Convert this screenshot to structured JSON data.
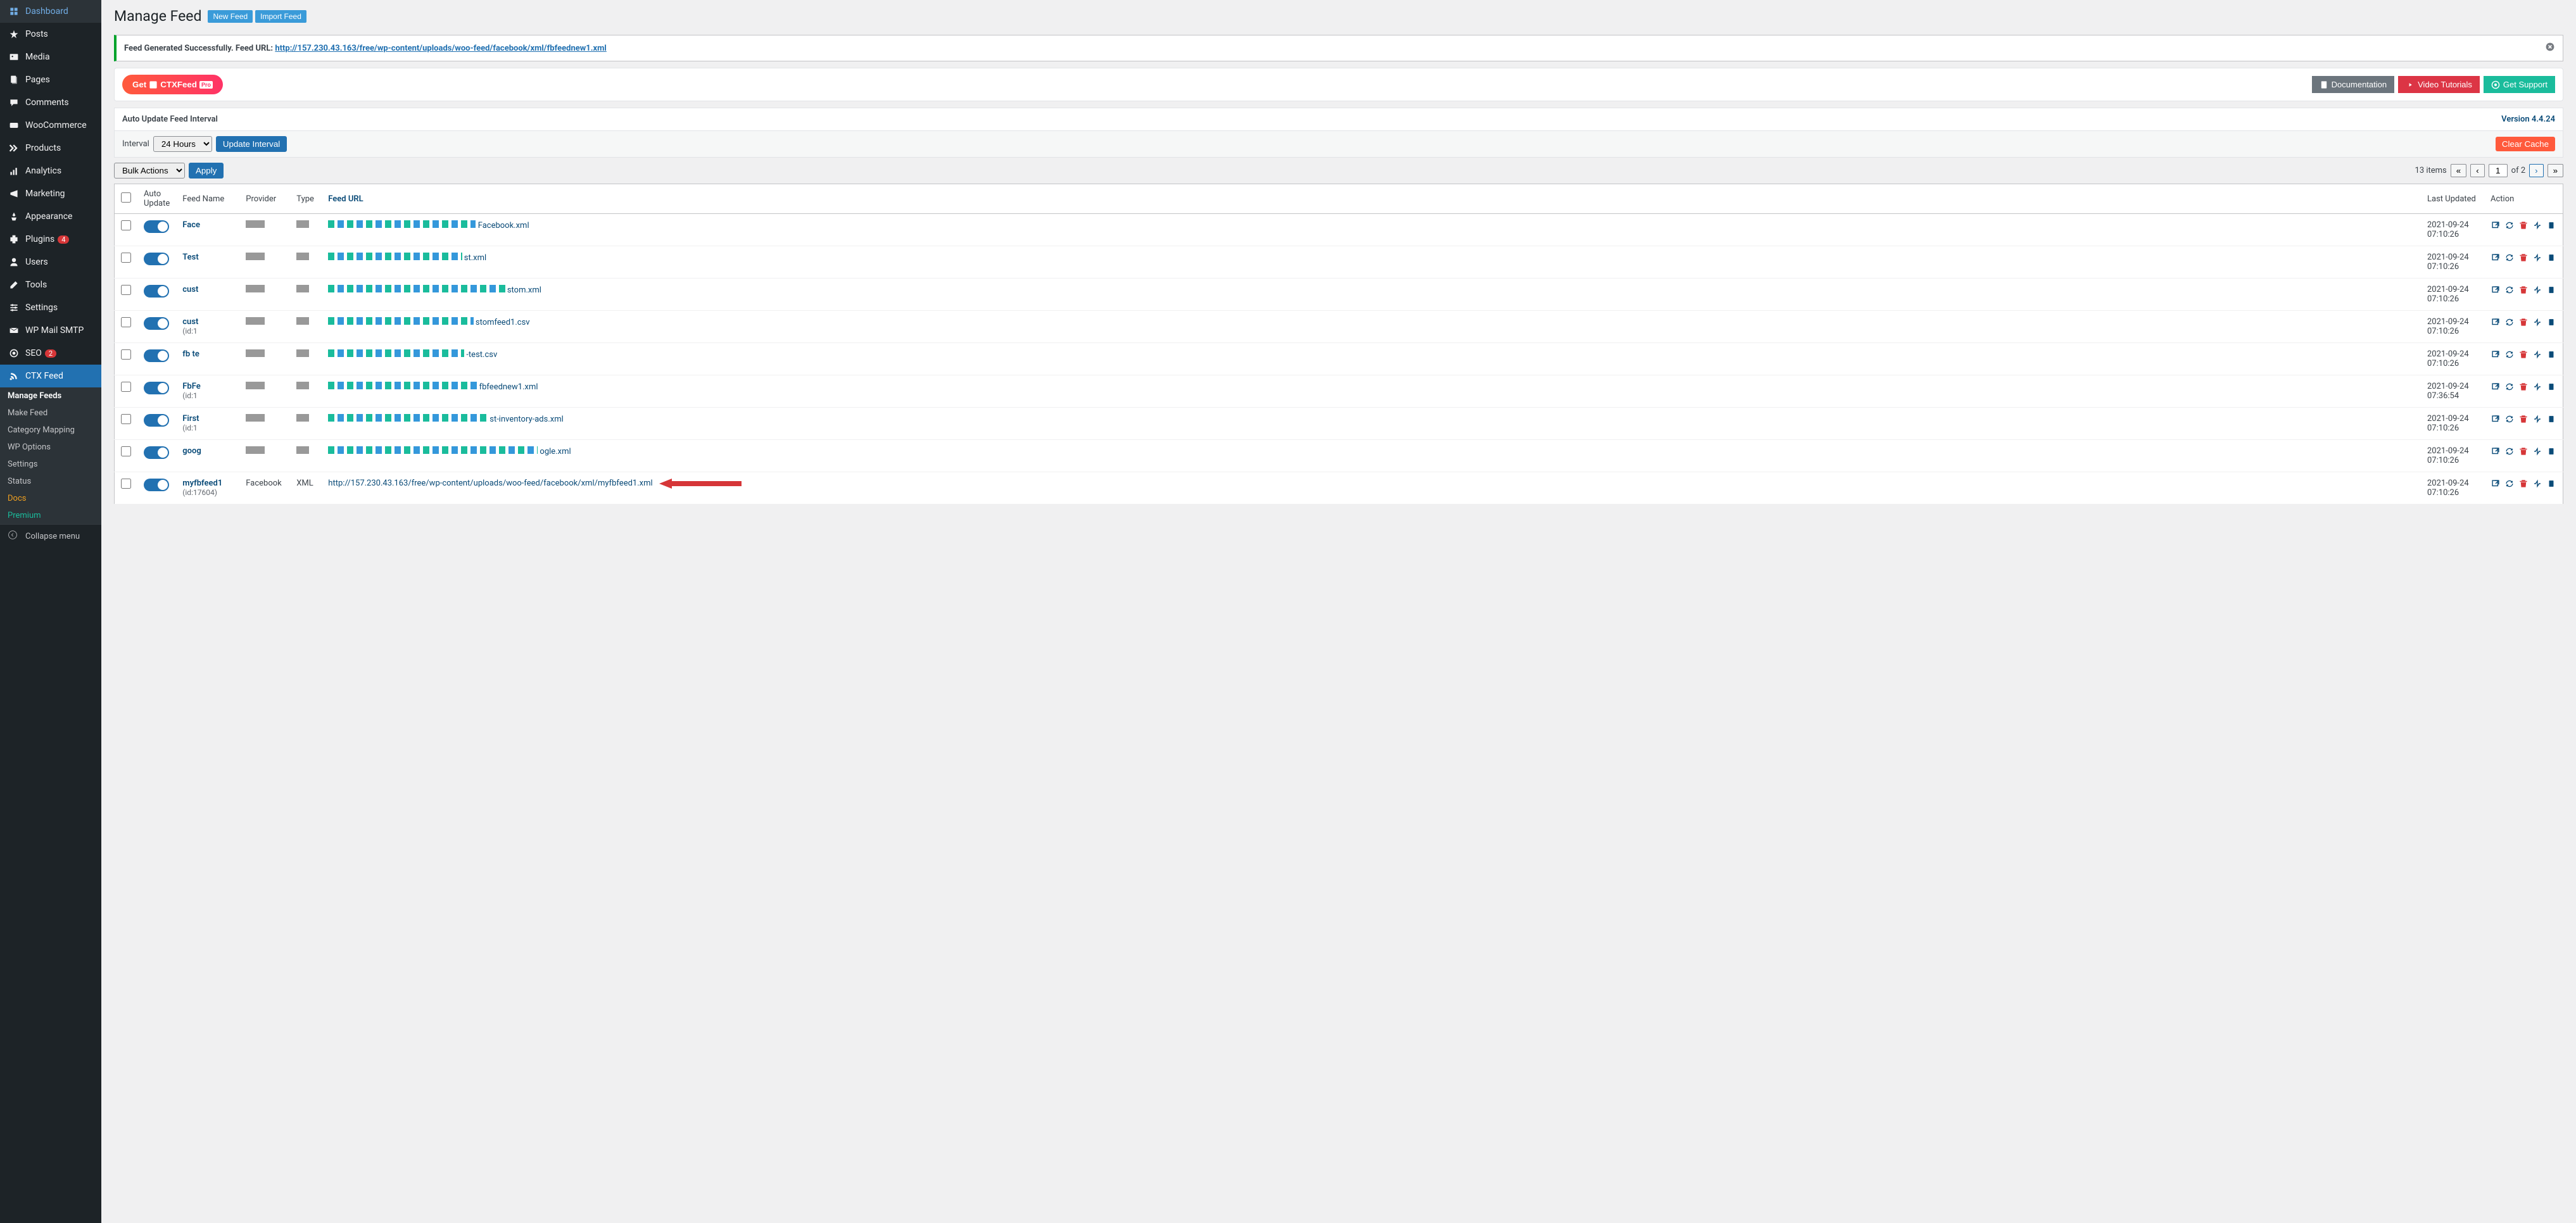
{
  "sidebar": {
    "items": [
      {
        "label": "Dashboard",
        "icon": "dashboard"
      },
      {
        "label": "Posts",
        "icon": "pin"
      },
      {
        "label": "Media",
        "icon": "media"
      },
      {
        "label": "Pages",
        "icon": "pages"
      },
      {
        "label": "Comments",
        "icon": "comments"
      },
      {
        "label": "WooCommerce",
        "icon": "woo"
      },
      {
        "label": "Products",
        "icon": "products"
      },
      {
        "label": "Analytics",
        "icon": "analytics"
      },
      {
        "label": "Marketing",
        "icon": "marketing"
      },
      {
        "label": "Appearance",
        "icon": "appearance"
      },
      {
        "label": "Plugins",
        "icon": "plugins",
        "badge": "4"
      },
      {
        "label": "Users",
        "icon": "users"
      },
      {
        "label": "Tools",
        "icon": "tools"
      },
      {
        "label": "Settings",
        "icon": "settings"
      },
      {
        "label": "WP Mail SMTP",
        "icon": "mail"
      },
      {
        "label": "SEO",
        "icon": "seo",
        "badge": "2"
      },
      {
        "label": "CTX Feed",
        "icon": "feed",
        "active": true
      }
    ],
    "submenu": [
      {
        "label": "Manage Feeds",
        "active": true
      },
      {
        "label": "Make Feed"
      },
      {
        "label": "Category Mapping"
      },
      {
        "label": "WP Options"
      },
      {
        "label": "Settings"
      },
      {
        "label": "Status"
      },
      {
        "label": "Docs",
        "class": "docs"
      },
      {
        "label": "Premium",
        "class": "premium"
      }
    ],
    "collapse": "Collapse menu"
  },
  "header": {
    "title": "Manage Feed",
    "new_feed": "New Feed",
    "import_feed": "Import Feed"
  },
  "notice": {
    "text": "Feed Generated Successfully. Feed URL: ",
    "url": "http://157.230.43.163/free/wp-content/uploads/woo-feed/facebook/xml/fbfeednew1.xml"
  },
  "ctx": {
    "get": "Get",
    "brand": "CTXFeed",
    "pro": "Pro"
  },
  "header_actions": {
    "docs": "Documentation",
    "video": "Video Tutorials",
    "support": "Get Support"
  },
  "interval": {
    "header": "Auto Update Feed Interval",
    "version": "Version 4.4.24",
    "label": "Interval",
    "selected": "24 Hours",
    "update": "Update Interval",
    "clear": "Clear Cache"
  },
  "controls": {
    "bulk": "Bulk Actions",
    "apply": "Apply",
    "items_count": "13 items",
    "page": "1",
    "total_pages": "of 2"
  },
  "columns": {
    "auto_update": "Auto Update",
    "feed_name": "Feed Name",
    "provider": "Provider",
    "type": "Type",
    "feed_url": "Feed URL",
    "last_updated": "Last Updated",
    "action": "Action"
  },
  "rows": [
    {
      "name": "Face",
      "id": "",
      "provider": "",
      "type": "",
      "url_suffix": "Facebook.xml",
      "updated": "2021-09-24 07:10:26"
    },
    {
      "name": "Test",
      "id": "",
      "provider": "",
      "type": "",
      "url_suffix": "st.xml",
      "updated": "2021-09-24 07:10:26"
    },
    {
      "name": "cust",
      "id": "",
      "provider": "",
      "type": "",
      "url_suffix": "stom.xml",
      "updated": "2021-09-24 07:10:26"
    },
    {
      "name": "cust",
      "id": "(id:1",
      "provider": "",
      "type": "",
      "url_suffix": "stomfeed1.csv",
      "updated": "2021-09-24 07:10:26"
    },
    {
      "name": "fb te",
      "id": "",
      "provider": "",
      "type": "",
      "url_suffix": "-test.csv",
      "updated": "2021-09-24 07:10:26"
    },
    {
      "name": "FbFe",
      "id": "(id:1",
      "provider": "",
      "type": "",
      "url_suffix": "fbfeednew1.xml",
      "updated": "2021-09-24 07:36:54"
    },
    {
      "name": "First",
      "id": "(id:1",
      "provider": "",
      "type": "",
      "url_suffix": "st-inventory-ads.xml",
      "updated": "2021-09-24 07:10:26"
    },
    {
      "name": "goog",
      "id": "",
      "provider": "",
      "type": "",
      "url_suffix": "ogle.xml",
      "updated": "2021-09-24 07:10:26"
    },
    {
      "name": "myfbfeed1",
      "id": "(id:17604)",
      "provider": "Facebook",
      "type": "XML",
      "url": "http://157.230.43.163/free/wp-content/uploads/woo-feed/facebook/xml/myfbfeed1.xml",
      "updated": "2021-09-24 07:10:26",
      "highlighted": true
    }
  ]
}
